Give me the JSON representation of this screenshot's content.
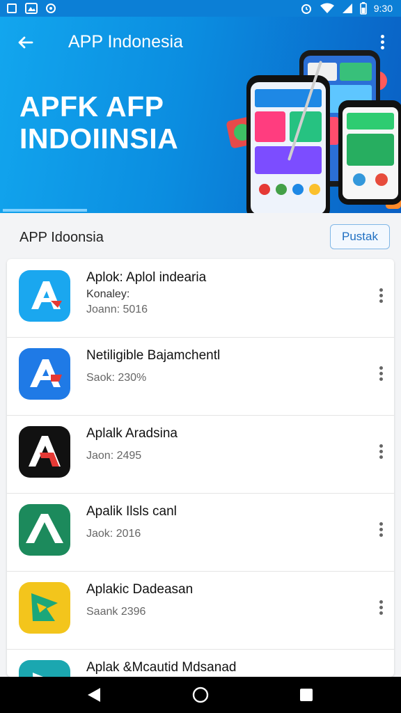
{
  "status_bar": {
    "time": "9:30"
  },
  "header": {
    "title": "APP Indonesia",
    "hero_line1": "APFK AFP",
    "hero_line2": "INDOIINSIA",
    "progress": 0.21
  },
  "section": {
    "title": "APP Idoonsia",
    "button_label": "Pustak"
  },
  "apps": [
    {
      "name": "Aplok: Aplol indearia",
      "sub": "Konaley:",
      "meta": "Joann: 5016",
      "icon_color": "#1aa7ef"
    },
    {
      "name": "Netiligible Bajamchentl",
      "sub": "",
      "meta": "Saok: 230%",
      "icon_color": "#1f7ae6"
    },
    {
      "name": "Aplalk Aradsina",
      "sub": "",
      "meta": "Jaon: 2495",
      "icon_color": "#111111"
    },
    {
      "name": "Apalik Ilsls canl",
      "sub": "",
      "meta": "Jaok: 2016",
      "icon_color": "#1c8a5c"
    },
    {
      "name": "Aplakic Dadeasan",
      "sub": "",
      "meta": "Saank 2396",
      "icon_color": "#f3c51c"
    },
    {
      "name": "Aplak &Mcautid Mdsanad",
      "sub": "",
      "meta": "",
      "icon_color": "#1ba7b0"
    }
  ],
  "icons": {
    "back": "arrow-left",
    "menu": "more-vert",
    "nav_back": "triangle-left",
    "nav_home": "circle",
    "nav_recent": "square"
  }
}
